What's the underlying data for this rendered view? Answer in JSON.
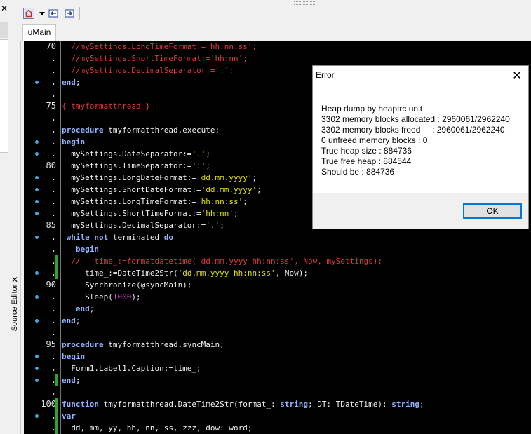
{
  "left_dock": {
    "close_glyph": "✕"
  },
  "source_editor": {
    "label": "Source Editor",
    "close_glyph": "✕"
  },
  "tabs": [
    {
      "label": "uMain"
    }
  ],
  "editor": {
    "lines": [
      {
        "num": "70",
        "bp": false,
        "mod": false,
        "tokens": [
          {
            "t": "  //mySettings.LongTimeFormat:='hh:nn:ss';",
            "c": "cm"
          }
        ]
      },
      {
        "num": ".",
        "bp": false,
        "mod": false,
        "tokens": [
          {
            "t": "  //mySettings.ShortTimeFormat:='hh:nn';",
            "c": "cm"
          }
        ]
      },
      {
        "num": ".",
        "bp": false,
        "mod": false,
        "tokens": [
          {
            "t": "  //mySettings.DecimalSeparator:='.';",
            "c": "cm"
          }
        ]
      },
      {
        "num": ".",
        "bp": true,
        "mod": false,
        "tokens": [
          {
            "t": "end",
            "c": "kw"
          },
          {
            "t": ";",
            "c": "tx"
          }
        ]
      },
      {
        "num": ".",
        "bp": false,
        "mod": false,
        "tokens": []
      },
      {
        "num": "75",
        "bp": false,
        "mod": false,
        "tokens": [
          {
            "t": "{ tmyformatthread }",
            "c": "cm"
          }
        ]
      },
      {
        "num": ".",
        "bp": false,
        "mod": false,
        "tokens": []
      },
      {
        "num": ".",
        "bp": false,
        "mod": false,
        "tokens": [
          {
            "t": "procedure",
            "c": "kw"
          },
          {
            "t": " tmyformatthread.execute;",
            "c": "tx"
          }
        ]
      },
      {
        "num": ".",
        "bp": true,
        "mod": false,
        "tokens": [
          {
            "t": "begin",
            "c": "kw"
          }
        ]
      },
      {
        "num": ".",
        "bp": true,
        "mod": false,
        "tokens": [
          {
            "t": "  mySettings.DateSeparator:=",
            "c": "tx"
          },
          {
            "t": "'.'",
            "c": "st"
          },
          {
            "t": ";",
            "c": "tx"
          }
        ]
      },
      {
        "num": "80",
        "bp": false,
        "mod": false,
        "tokens": [
          {
            "t": "  mySettings.TimeSeparator:=",
            "c": "tx"
          },
          {
            "t": "':'",
            "c": "st"
          },
          {
            "t": ";",
            "c": "tx"
          }
        ]
      },
      {
        "num": ".",
        "bp": true,
        "mod": false,
        "tokens": [
          {
            "t": "  mySettings.LongDateFormat:=",
            "c": "tx"
          },
          {
            "t": "'dd.mm.yyyy'",
            "c": "st"
          },
          {
            "t": ";",
            "c": "tx"
          }
        ]
      },
      {
        "num": ".",
        "bp": true,
        "mod": false,
        "tokens": [
          {
            "t": "  mySettings.ShortDateFormat:=",
            "c": "tx"
          },
          {
            "t": "'dd.mm.yyyy'",
            "c": "st"
          },
          {
            "t": ";",
            "c": "tx"
          }
        ]
      },
      {
        "num": ".",
        "bp": true,
        "mod": false,
        "tokens": [
          {
            "t": "  mySettings.LongTimeFormat:=",
            "c": "tx"
          },
          {
            "t": "'hh:nn:ss'",
            "c": "st"
          },
          {
            "t": ";",
            "c": "tx"
          }
        ]
      },
      {
        "num": ".",
        "bp": true,
        "mod": false,
        "tokens": [
          {
            "t": "  mySettings.ShortTimeFormat:=",
            "c": "tx"
          },
          {
            "t": "'hh:nn'",
            "c": "st"
          },
          {
            "t": ";",
            "c": "tx"
          }
        ]
      },
      {
        "num": "85",
        "bp": false,
        "mod": false,
        "tokens": [
          {
            "t": "  mySettings.DecimalSeparator:=",
            "c": "tx"
          },
          {
            "t": "'.'",
            "c": "st"
          },
          {
            "t": ";",
            "c": "tx"
          }
        ]
      },
      {
        "num": ".",
        "bp": true,
        "mod": false,
        "tokens": [
          {
            "t": " while not",
            "c": "kw"
          },
          {
            "t": " terminated ",
            "c": "tx"
          },
          {
            "t": "do",
            "c": "kw"
          }
        ]
      },
      {
        "num": ".",
        "bp": false,
        "mod": false,
        "tokens": [
          {
            "t": "   begin",
            "c": "kw"
          }
        ]
      },
      {
        "num": ".",
        "bp": false,
        "mod": true,
        "tokens": [
          {
            "t": "  //   time_:=formatdatetime('dd.mm.yyyy hh:nn:ss', Now, mySettings);",
            "c": "cm"
          }
        ]
      },
      {
        "num": ".",
        "bp": true,
        "mod": true,
        "tokens": [
          {
            "t": "     time_:=DateTime2Str(",
            "c": "tx"
          },
          {
            "t": "'dd.mm.yyyy hh:nn:ss'",
            "c": "st"
          },
          {
            "t": ", Now);",
            "c": "tx"
          }
        ]
      },
      {
        "num": "90",
        "bp": false,
        "mod": false,
        "tokens": [
          {
            "t": "     Synchronize(@syncMain);",
            "c": "tx"
          }
        ]
      },
      {
        "num": ".",
        "bp": true,
        "mod": false,
        "tokens": [
          {
            "t": "     Sleep(",
            "c": "tx"
          },
          {
            "t": "1000",
            "c": "nm"
          },
          {
            "t": ");",
            "c": "tx"
          }
        ]
      },
      {
        "num": ".",
        "bp": false,
        "mod": false,
        "tokens": [
          {
            "t": "   end",
            "c": "kw"
          },
          {
            "t": ";",
            "c": "tx"
          }
        ]
      },
      {
        "num": ".",
        "bp": true,
        "mod": false,
        "tokens": [
          {
            "t": "end",
            "c": "kw"
          },
          {
            "t": ";",
            "c": "tx"
          }
        ]
      },
      {
        "num": ".",
        "bp": false,
        "mod": false,
        "tokens": []
      },
      {
        "num": "95",
        "bp": false,
        "mod": false,
        "tokens": [
          {
            "t": "procedure",
            "c": "kw"
          },
          {
            "t": " tmyformatthread.syncMain;",
            "c": "tx"
          }
        ]
      },
      {
        "num": ".",
        "bp": true,
        "mod": false,
        "tokens": [
          {
            "t": "begin",
            "c": "kw"
          }
        ]
      },
      {
        "num": ".",
        "bp": true,
        "mod": false,
        "tokens": [
          {
            "t": "  Form1.Label1.Caption:=time_;",
            "c": "tx"
          }
        ]
      },
      {
        "num": ".",
        "bp": true,
        "mod": true,
        "tokens": [
          {
            "t": "end",
            "c": "kw"
          },
          {
            "t": ";",
            "c": "tx"
          }
        ]
      },
      {
        "num": ".",
        "bp": false,
        "mod": false,
        "tokens": []
      },
      {
        "num": "100",
        "bp": false,
        "mod": true,
        "tokens": [
          {
            "t": "function",
            "c": "kw"
          },
          {
            "t": " tmyformatthread.DateTime2Str(format_: ",
            "c": "tx"
          },
          {
            "t": "string",
            "c": "kw"
          },
          {
            "t": "; DT: TDateTime): ",
            "c": "tx"
          },
          {
            "t": "string",
            "c": "kw"
          },
          {
            "t": ";",
            "c": "tx"
          }
        ]
      },
      {
        "num": ".",
        "bp": true,
        "mod": true,
        "tokens": [
          {
            "t": "var",
            "c": "kw"
          }
        ]
      },
      {
        "num": ".",
        "bp": false,
        "mod": true,
        "tokens": [
          {
            "t": "  dd, mm, yy, hh, nn, ss, zzz, dow: word;",
            "c": "tx"
          }
        ]
      }
    ]
  },
  "dialog": {
    "title": "Error",
    "close_glyph": "✕",
    "message": "Heap dump by heaptrc unit\n3302 memory blocks allocated : 2960061/2962240\n3302 memory blocks freed     : 2960061/2962240\n0 unfreed memory blocks : 0\nTrue heap size : 884736\nTrue free heap : 884544\nShould be : 884736",
    "ok_label": "OK"
  }
}
